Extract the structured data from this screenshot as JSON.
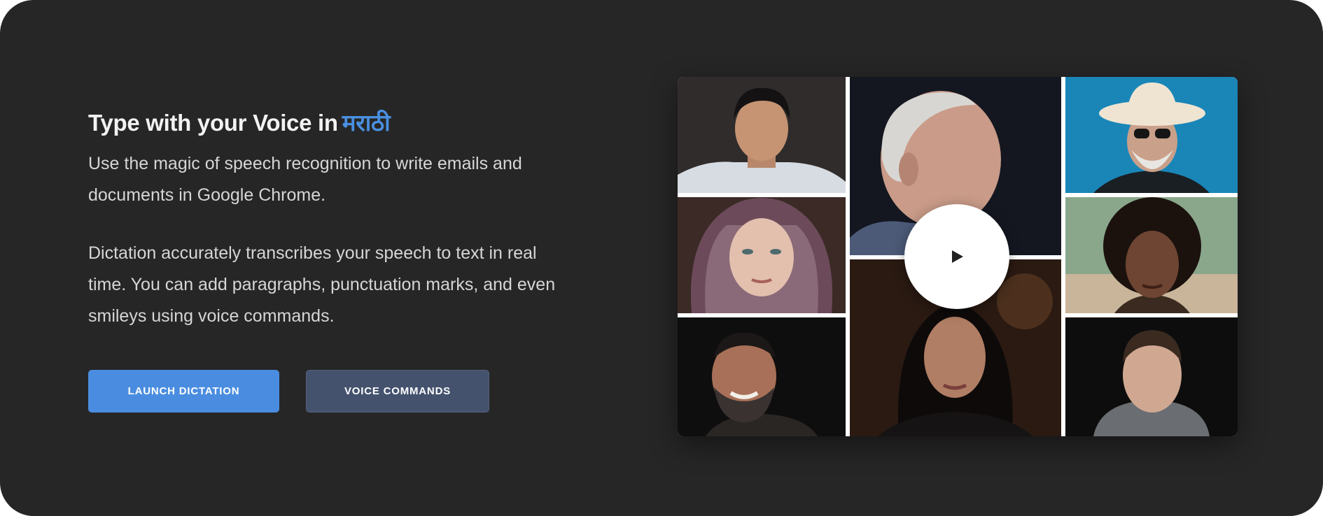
{
  "hero": {
    "title_prefix": "Type with your Voice in",
    "title_language": "मराठी",
    "paragraph_1": "Use the magic of speech recognition to write emails and documents in Google Chrome.",
    "paragraph_2": "Dictation accurately transcribes your speech to text in real time. You can add paragraphs, punctuation marks, and even smileys using voice commands."
  },
  "buttons": {
    "launch_label": "LAUNCH DICTATION",
    "commands_label": "VOICE COMMANDS"
  },
  "colors": {
    "background": "#262626",
    "accent": "#4a8de0",
    "secondary_button": "#44526e"
  },
  "media": {
    "play_icon": "play-icon",
    "portraits": [
      "young man in light shirt",
      "elderly man in profile",
      "man in cowboy hat and sunglasses",
      "woman in patterned headscarf",
      "woman with curly hair",
      "smiling bearded man",
      "woman with long dark hair",
      "man in grey hoodie"
    ]
  }
}
